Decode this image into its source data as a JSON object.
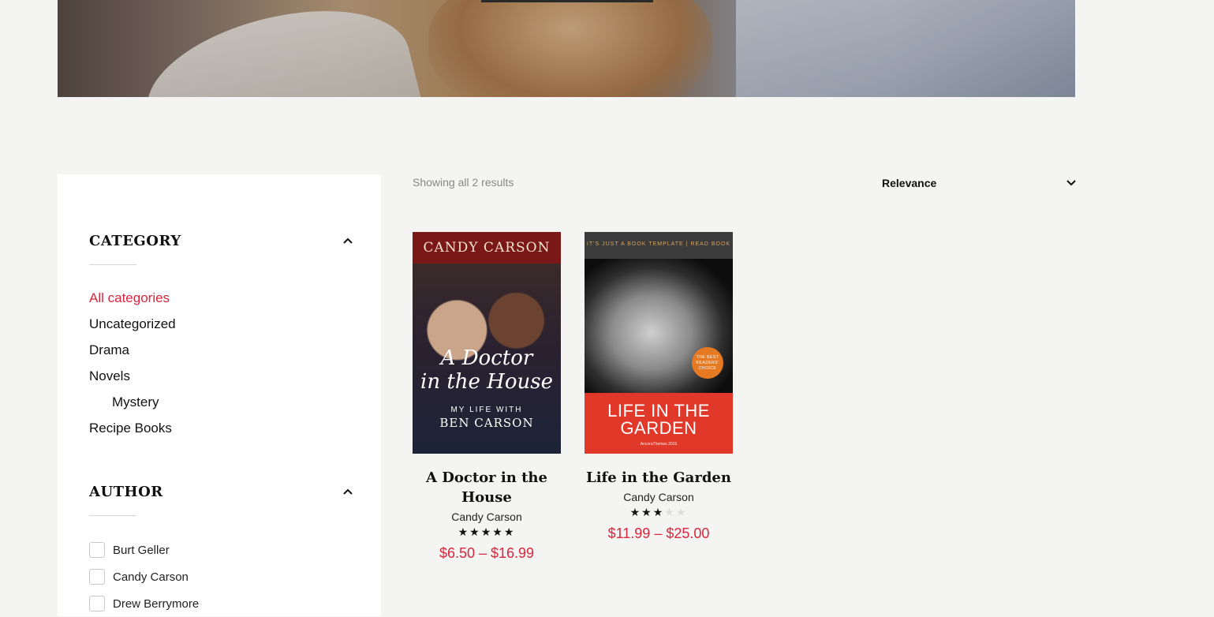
{
  "hero": {},
  "sidebar": {
    "category": {
      "title": "CATEGORY",
      "items": [
        {
          "label": "All categories",
          "active": true
        },
        {
          "label": "Uncategorized"
        },
        {
          "label": "Drama"
        },
        {
          "label": "Novels"
        },
        {
          "label": "Mystery",
          "child": true
        },
        {
          "label": "Recipe Books"
        }
      ]
    },
    "author": {
      "title": "AUTHOR",
      "items": [
        {
          "label": "Burt Geller"
        },
        {
          "label": "Candy Carson"
        },
        {
          "label": "Drew Berrymore"
        }
      ]
    }
  },
  "toolbar": {
    "result_count": "Showing all 2 results",
    "sort_value": "Relevance"
  },
  "products": [
    {
      "title_line1": "A Doctor in the",
      "title_line2": "House",
      "author": "Candy Carson",
      "rating": 5,
      "price": "$6.50 – $16.99",
      "cover": {
        "author": "CANDY CARSON",
        "script_line1": "A Doctor",
        "script_line2": "in the House",
        "subtitle": "MY LIFE WITH",
        "subtitle2": "BEN CARSON"
      }
    },
    {
      "title_line1": "Life in the Garden",
      "title_line2": "",
      "author": "Candy Carson",
      "rating": 3,
      "price": "$11.99 – $25.00",
      "cover": {
        "strip": "IT'S JUST A BOOK TEMPLATE  |  READ BOOK",
        "badge": "THE BEST READERS' CHOICE",
        "title_line1": "LIFE IN THE",
        "title_line2": "GARDEN",
        "footer": "AncoraThemes 2019"
      }
    }
  ],
  "colors": {
    "accent": "#d7263d",
    "background": "#f4f4f2"
  }
}
